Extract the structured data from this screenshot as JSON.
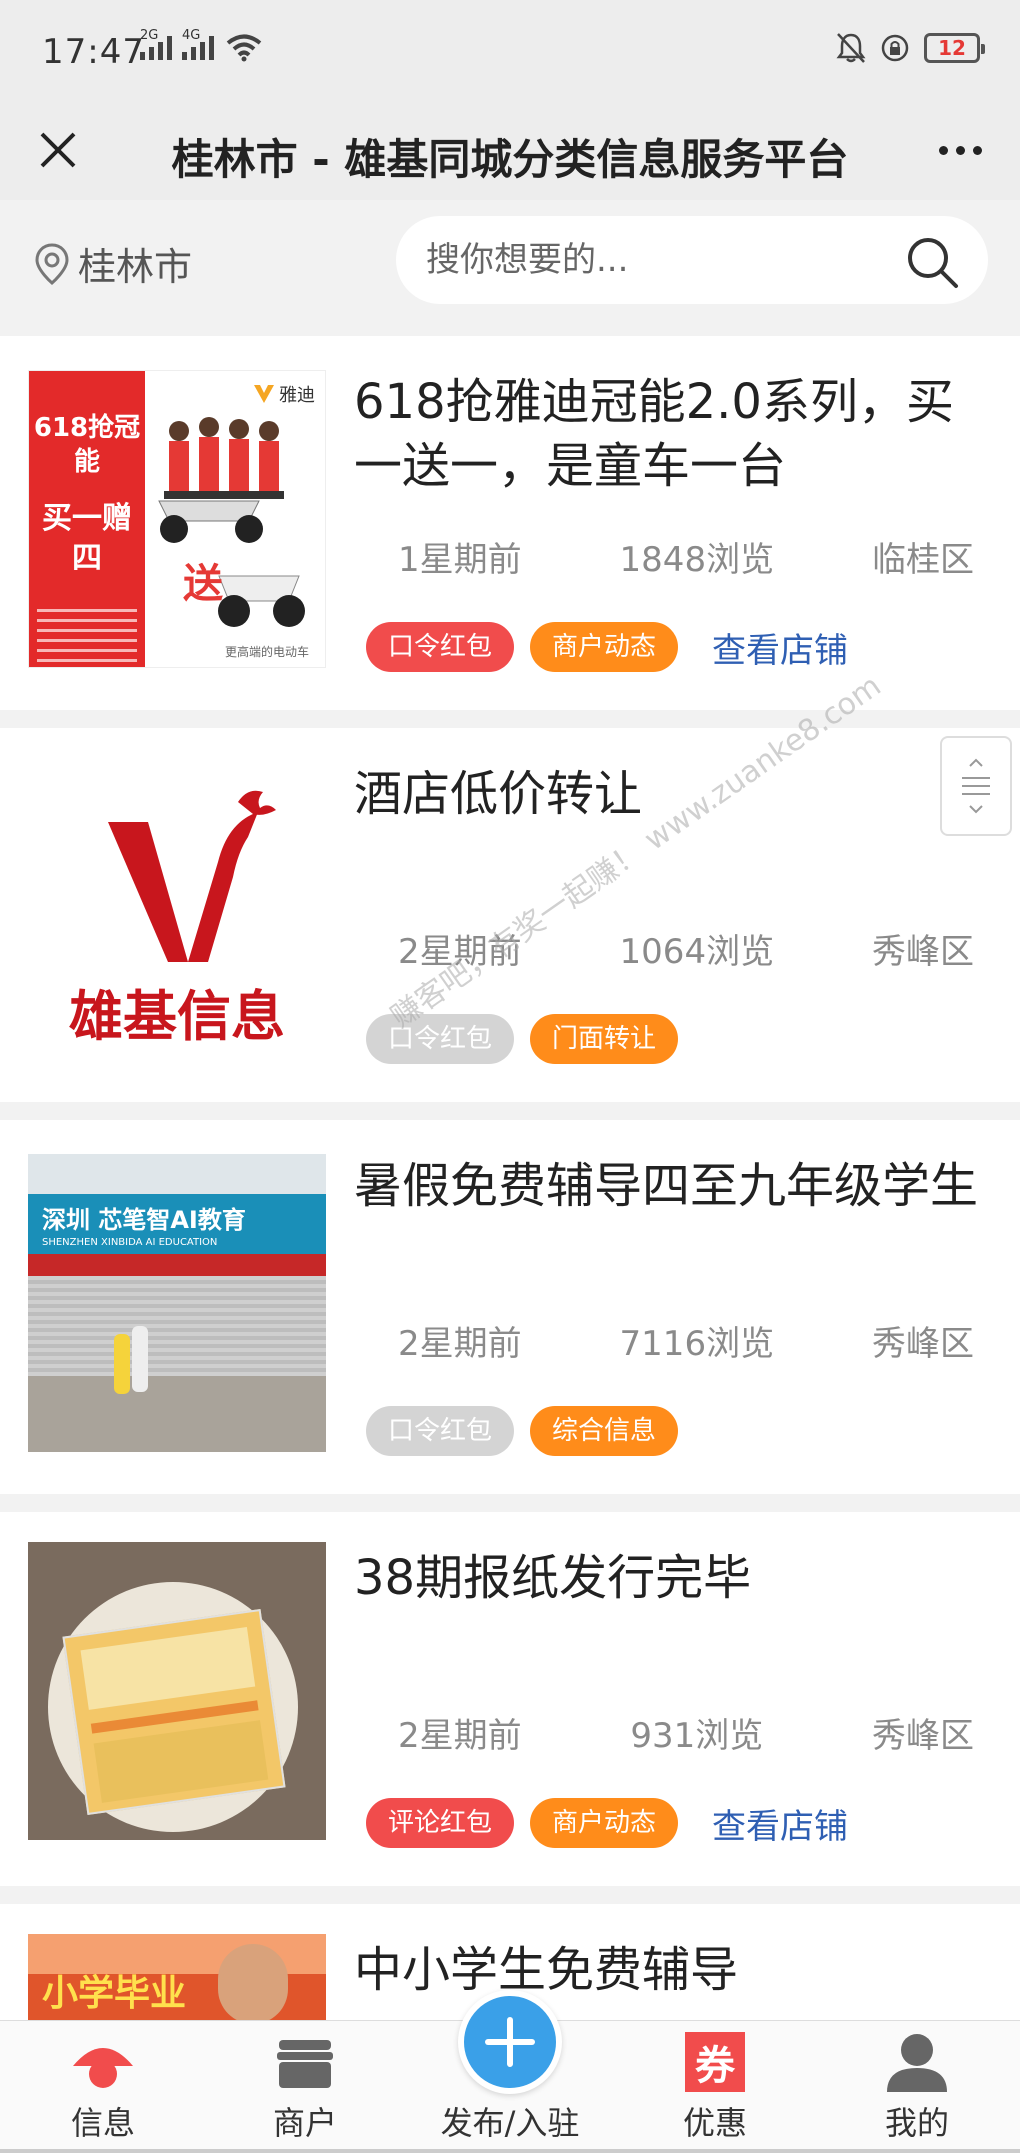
{
  "status_bar": {
    "time": "17:47",
    "signal1_label": "2G",
    "signal2_label": "4G",
    "battery": "12"
  },
  "header": {
    "title": "桂林市 - 雄基同城分类信息服务平台"
  },
  "location": {
    "city": "桂林市"
  },
  "search": {
    "placeholder": "搜你想要的..."
  },
  "posts": [
    {
      "title": "618抢雅迪冠能2.0系列，买一送一，是童车一台",
      "time": "1星期前",
      "views": "1848浏览",
      "district": "临桂区",
      "tags": [
        "口令红包",
        "商户动态"
      ],
      "link": "查看店铺",
      "thumb_text": {
        "line1": "618抢冠能",
        "line2": "买一赠四",
        "brand": "雅迪",
        "gift": "送",
        "slogan": "更高端的电动车"
      }
    },
    {
      "title": "酒店低价转让",
      "time": "2星期前",
      "views": "1064浏览",
      "district": "秀峰区",
      "tags": [
        "口令红包",
        "门面转让"
      ],
      "thumb_text": {
        "logo": "雄基信息"
      }
    },
    {
      "title": "暑假免费辅导四至九年级学生",
      "time": "2星期前",
      "views": "7116浏览",
      "district": "秀峰区",
      "tags": [
        "口令红包",
        "综合信息"
      ],
      "thumb_text": {
        "sign": "深圳 芯笔智AI教育",
        "sign_en": "SHENZHEN XINBIDA AI EDUCATION"
      }
    },
    {
      "title": "38期报纸发行完毕",
      "time": "2星期前",
      "views": "931浏览",
      "district": "秀峰区",
      "tags": [
        "评论红包",
        "商户动态"
      ],
      "link": "查看店铺"
    },
    {
      "title": "中小学生免费辅导",
      "thumb_text": {
        "banner": "小学毕业"
      }
    }
  ],
  "watermark": "赚客吧，有奖一起赚！ www.zuanke8.com",
  "tab_bar": {
    "items": [
      {
        "label": "信息",
        "icon": "info-icon"
      },
      {
        "label": "商户",
        "icon": "shop-icon"
      },
      {
        "label": "发布/入驻",
        "icon": "plus-icon"
      },
      {
        "label": "优惠",
        "icon": "coupon-icon",
        "glyph": "券"
      },
      {
        "label": "我的",
        "icon": "user-icon"
      }
    ]
  },
  "colors": {
    "tag_red": "#f14c4c",
    "tag_orange": "#ff8c1a",
    "tag_gray": "#d4d4d4",
    "link_blue": "#2f5fb3",
    "fab_blue": "#3aa0e8",
    "info_red": "#f14c4c"
  }
}
